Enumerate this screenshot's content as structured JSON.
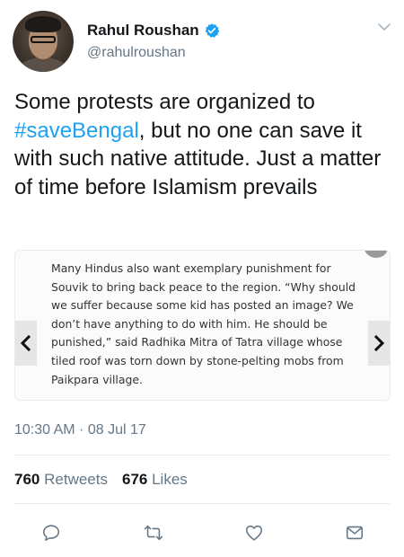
{
  "author": {
    "name": "Rahul Roushan",
    "handle": "@rahulroushan"
  },
  "tweet": {
    "text_before": "Some protests are organized to ",
    "hashtag": "#saveBengal",
    "text_after": ", but no one can save it with such native attitude. Just a matter of time before Islamism prevails"
  },
  "card": {
    "text": "Many Hindus also want exemplary punishment for Souvik to bring back peace to the region. “Why should we suffer because some kid has posted an image? We don’t have anything to do with him. He should be punished,” said Radhika Mitra of Tatra village whose tiled roof was torn down by stone-pelting mobs from Paikpara village."
  },
  "timestamp": "10:30 AM · 08 Jul 17",
  "stats": {
    "retweets_count": "760",
    "retweets_label": "Retweets",
    "likes_count": "676",
    "likes_label": "Likes"
  },
  "colors": {
    "accent": "#1da1f2",
    "text": "#14171a",
    "muted": "#657786",
    "border": "#e6ecf0"
  },
  "icons": [
    "verified-badge-icon",
    "chevron-down-icon",
    "chevron-left-icon",
    "chevron-right-icon",
    "reply-icon",
    "retweet-icon",
    "like-icon",
    "share-icon"
  ]
}
